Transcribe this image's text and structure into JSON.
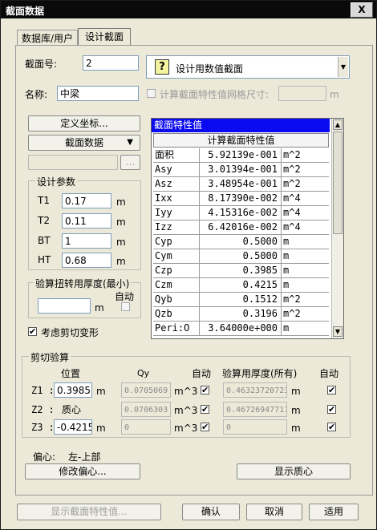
{
  "window": {
    "title": "截面数据",
    "close_glyph": "X"
  },
  "tabs": [
    {
      "label": "数据库/用户"
    },
    {
      "label": "设计截面"
    }
  ],
  "section": {
    "number_label": "截面号:",
    "number_value": "2",
    "name_label": "名称:",
    "name_value": "中梁",
    "type_value": "设计用数值截面",
    "grid_check_label": "计算截面特性值网格尺寸:",
    "grid_unit": "m"
  },
  "buttons": {
    "define_coords": "定义坐标...",
    "section_data": "截面数据",
    "browse": "...",
    "modify_offset": "修改偏心...",
    "show_centroid": "显示质心",
    "show_properties": "显示截面特性值...",
    "ok": "确认",
    "cancel": "取消",
    "apply": "适用"
  },
  "design_params": {
    "title": "设计参数",
    "rows": [
      {
        "label": "T1",
        "value": "0.17",
        "unit": "m"
      },
      {
        "label": "T2",
        "value": "0.11",
        "unit": "m"
      },
      {
        "label": "BT",
        "value": "1",
        "unit": "m"
      },
      {
        "label": "HT",
        "value": "0.68",
        "unit": "m"
      }
    ]
  },
  "torsion": {
    "title": "验算扭转用厚度(最小)",
    "auto_label": "自动",
    "unit": "m"
  },
  "shear_deform": {
    "label": "考虑剪切变形",
    "checked": "✔"
  },
  "properties": {
    "header": "截面特性值",
    "column_header": "计算截面特性值",
    "rows": [
      {
        "name": "面积",
        "value": "5.92139e-001",
        "unit": "m^2"
      },
      {
        "name": "Asy",
        "value": "3.01394e-001",
        "unit": "m^2"
      },
      {
        "name": "Asz",
        "value": "3.48954e-001",
        "unit": "m^2"
      },
      {
        "name": "Ixx",
        "value": "8.17390e-002",
        "unit": "m^4"
      },
      {
        "name": "Iyy",
        "value": "4.15316e-002",
        "unit": "m^4"
      },
      {
        "name": "Izz",
        "value": "6.42016e-002",
        "unit": "m^4"
      },
      {
        "name": "Cyp",
        "value": "0.5000",
        "unit": "m"
      },
      {
        "name": "Cym",
        "value": "0.5000",
        "unit": "m"
      },
      {
        "name": "Czp",
        "value": "0.3985",
        "unit": "m"
      },
      {
        "name": "Czm",
        "value": "0.4215",
        "unit": "m"
      },
      {
        "name": "Qyb",
        "value": "0.1512",
        "unit": "m^2"
      },
      {
        "name": "Qzb",
        "value": "0.3196",
        "unit": "m^2"
      },
      {
        "name": "Peri:O",
        "value": "3.64000e+000",
        "unit": "m"
      }
    ]
  },
  "shear_check": {
    "title": "剪切验算",
    "headers": {
      "position": "位置",
      "qy": "Qy",
      "auto1": "自动",
      "thickness": "验算用厚度(所有)",
      "auto2": "自动"
    },
    "rows": [
      {
        "label": "Z1 :",
        "position": "0.3985",
        "pos_unit": "m",
        "sublabel": "",
        "qy": "0.0705069",
        "qy_unit": "m^3",
        "thickness": "0.463237207233",
        "t_unit": "m"
      },
      {
        "label": "Z2 :",
        "position": "",
        "pos_unit": "",
        "sublabel": "质心",
        "qy": "0.0706303",
        "qy_unit": "m^3",
        "thickness": "0.467269477171",
        "t_unit": "m"
      },
      {
        "label": "Z3 :",
        "position": "-0.4215",
        "pos_unit": "m",
        "sublabel": "",
        "qy": "0",
        "qy_unit": "m^3",
        "thickness": "0",
        "t_unit": "m"
      }
    ],
    "check_glyph": "✔"
  },
  "offset": {
    "label": "偏心:",
    "value": "左-上部"
  }
}
